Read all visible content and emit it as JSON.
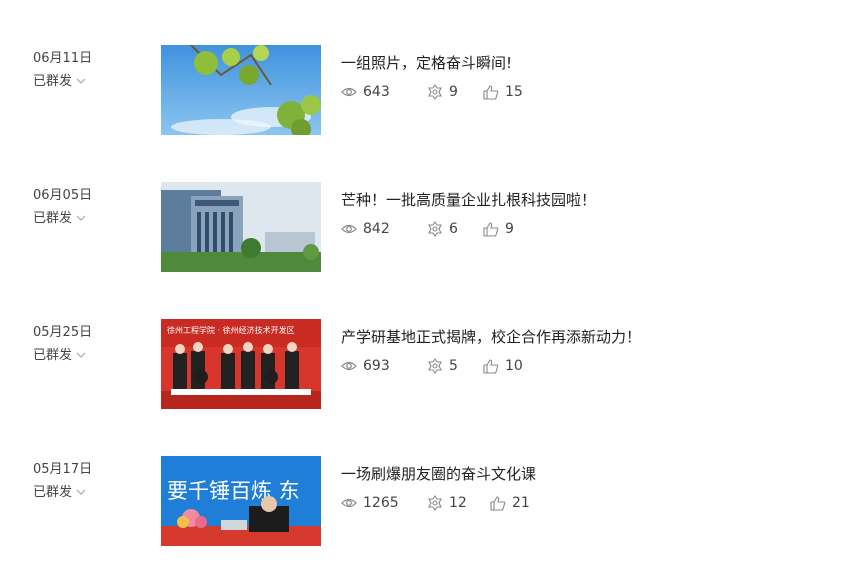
{
  "articles": [
    {
      "date": "06月11日",
      "status": "已群发",
      "title": "一组照片，定格奋斗瞬间!",
      "views": "643",
      "shares": "9",
      "likes": "15"
    },
    {
      "date": "06月05日",
      "status": "已群发",
      "title": "芒种！一批高质量企业扎根科技园啦！",
      "views": "842",
      "shares": "6",
      "likes": "9"
    },
    {
      "date": "05月25日",
      "status": "已群发",
      "title": "产学研基地正式揭牌，校企合作再添新动力！",
      "views": "693",
      "shares": "5",
      "likes": "10"
    },
    {
      "date": "05月17日",
      "status": "已群发",
      "title": "一场刷爆朋友圈的奋斗文化课",
      "views": "1265",
      "shares": "12",
      "likes": "21"
    }
  ],
  "thumb_text": {
    "banner2": "徐州工程学院 · 徐州经济技术开发区",
    "banner3": "要千锤百炼 东"
  },
  "icons": {
    "status": "chevron-down-icon",
    "views": "eye-icon",
    "shares": "share-icon",
    "likes": "thumbs-up-icon"
  },
  "colors": {
    "text": "#333333",
    "muted": "#999999",
    "accent_red": "#d9322a",
    "sky": "#5aa8e6"
  }
}
